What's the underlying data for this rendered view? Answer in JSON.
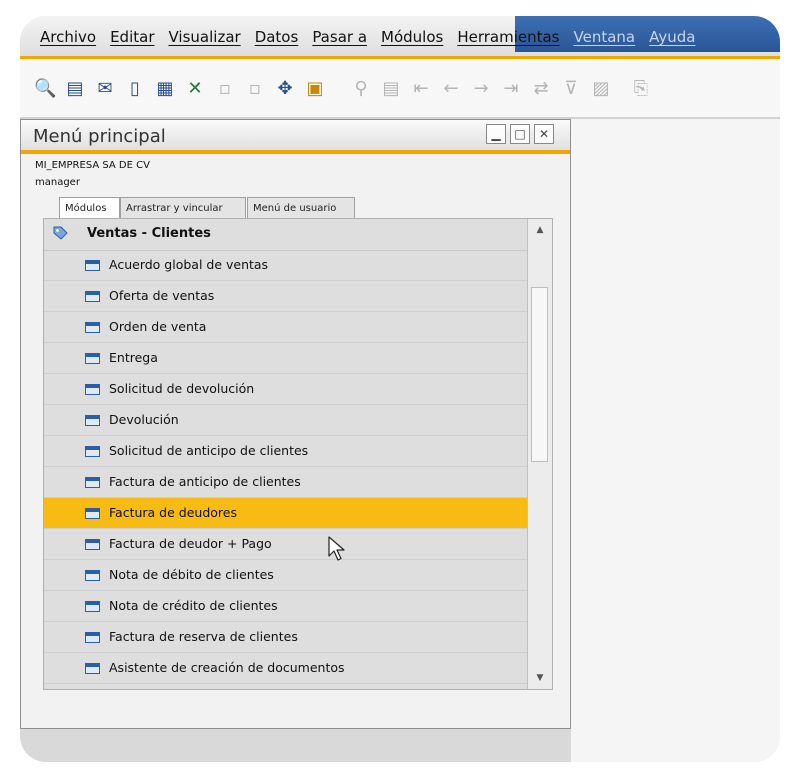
{
  "menubar": {
    "items": [
      {
        "label": "Archivo",
        "dim": false
      },
      {
        "label": "Editar",
        "dim": false
      },
      {
        "label": "Visualizar",
        "dim": false
      },
      {
        "label": "Datos",
        "dim": false
      },
      {
        "label": "Pasar a",
        "dim": false
      },
      {
        "label": "Módulos",
        "dim": false
      },
      {
        "label": "Herramientas",
        "dim": false
      },
      {
        "label": "Ventana",
        "dim": true
      },
      {
        "label": "Ayuda",
        "dim": true
      }
    ]
  },
  "colors": {
    "accent": "#f0a800",
    "selection": "#f8bb14",
    "title_blue": "#2a5698"
  },
  "toolbar": {
    "icons": [
      "preview-icon",
      "print-icon",
      "email-icon",
      "sms-icon",
      "fax-icon",
      "excel-export-icon",
      "word-export-icon",
      "pdf-export-icon",
      "navigate-icon",
      "lock-icon",
      "find-icon",
      "add-icon",
      "first-record-icon",
      "previous-record-icon",
      "next-record-icon",
      "last-record-icon",
      "refresh-icon",
      "filter-icon",
      "sort-icon",
      "copy-icon"
    ]
  },
  "window": {
    "title": "Menú principal",
    "company": "MI_EMPRESA SA DE CV",
    "user": "manager",
    "tabs": [
      {
        "label": "Módulos",
        "active": true
      },
      {
        "label": "Arrastrar y vincular",
        "active": false
      },
      {
        "label": "Menú de usuario",
        "active": false
      }
    ],
    "section": "Ventas - Clientes",
    "items": [
      {
        "label": "Acuerdo global de ventas",
        "selected": false
      },
      {
        "label": "Oferta de ventas",
        "selected": false
      },
      {
        "label": "Orden de venta",
        "selected": false
      },
      {
        "label": "Entrega",
        "selected": false
      },
      {
        "label": "Solicitud de devolución",
        "selected": false
      },
      {
        "label": "Devolución",
        "selected": false
      },
      {
        "label": "Solicitud de anticipo de clientes",
        "selected": false
      },
      {
        "label": "Factura de anticipo de clientes",
        "selected": false
      },
      {
        "label": "Factura de deudores",
        "selected": true
      },
      {
        "label": "Factura de deudor + Pago",
        "selected": false
      },
      {
        "label": "Nota de débito de clientes",
        "selected": false
      },
      {
        "label": "Nota de crédito de clientes",
        "selected": false
      },
      {
        "label": "Factura de reserva de clientes",
        "selected": false
      },
      {
        "label": "Asistente de creación de documentos",
        "selected": false
      }
    ]
  }
}
